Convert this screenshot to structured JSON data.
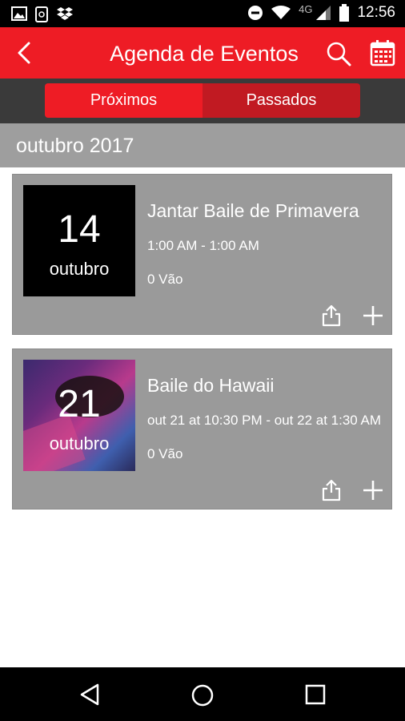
{
  "status_bar": {
    "time": "12:56",
    "network": "4G",
    "icons": [
      "image-icon",
      "phone-sync-icon",
      "dropbox-icon",
      "do-not-disturb-icon",
      "wifi-icon",
      "signal-icon",
      "battery-icon"
    ]
  },
  "app_bar": {
    "title": "Agenda de Eventos",
    "icons": [
      "back-arrow-icon",
      "search-icon",
      "calendar-icon"
    ]
  },
  "tabs": {
    "upcoming": "Próximos",
    "past": "Passados",
    "selected": "past"
  },
  "month_header": "outubro 2017",
  "events": [
    {
      "day": "14",
      "month": "outubro",
      "title": "Jantar Baile de Primavera",
      "time": "1:00 AM - 1:00 AM",
      "going": "0 Vão",
      "has_image": false
    },
    {
      "day": "21",
      "month": "outubro",
      "title": "Baile do Hawaii",
      "time": "out 21 at 10:30 PM - out 22 at 1:30 AM",
      "going": "0 Vão",
      "has_image": true
    }
  ],
  "colors": {
    "accent": "#ee1c25",
    "tab_selected": "#c11a22",
    "tabs_background": "#3a3a3a",
    "card": "#9a9a9a",
    "month_header": "#9e9e9e"
  },
  "nav_bar": {
    "icons": [
      "nav-back-icon",
      "nav-home-icon",
      "nav-recents-icon"
    ]
  }
}
